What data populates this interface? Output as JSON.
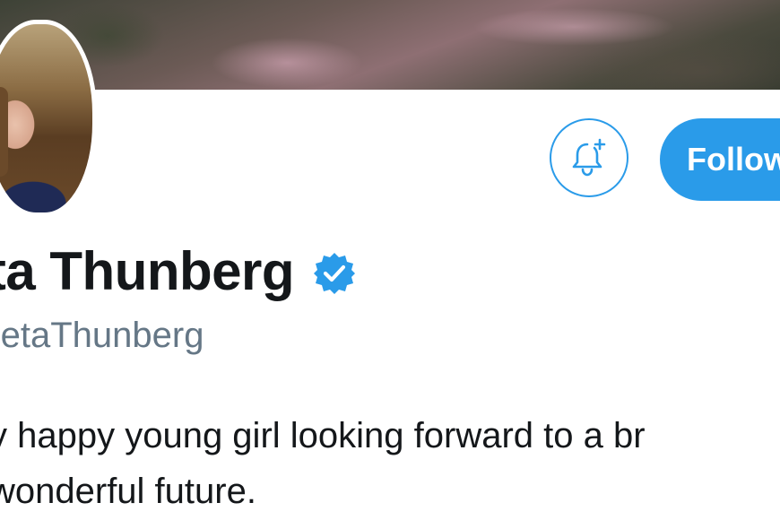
{
  "profile": {
    "display_name": "eta Thunberg",
    "handle": "etaThunberg",
    "verified": true,
    "bio_lines": [
      "y happy young girl looking forward to a br",
      "wonderful future."
    ]
  },
  "actions": {
    "notifications_icon": "bell-plus-icon",
    "follow_label": "Follow"
  },
  "colors": {
    "accent": "#2a9be9",
    "text_primary": "#14171a",
    "text_secondary": "#657786",
    "verified_badge": "#2a9be9"
  }
}
